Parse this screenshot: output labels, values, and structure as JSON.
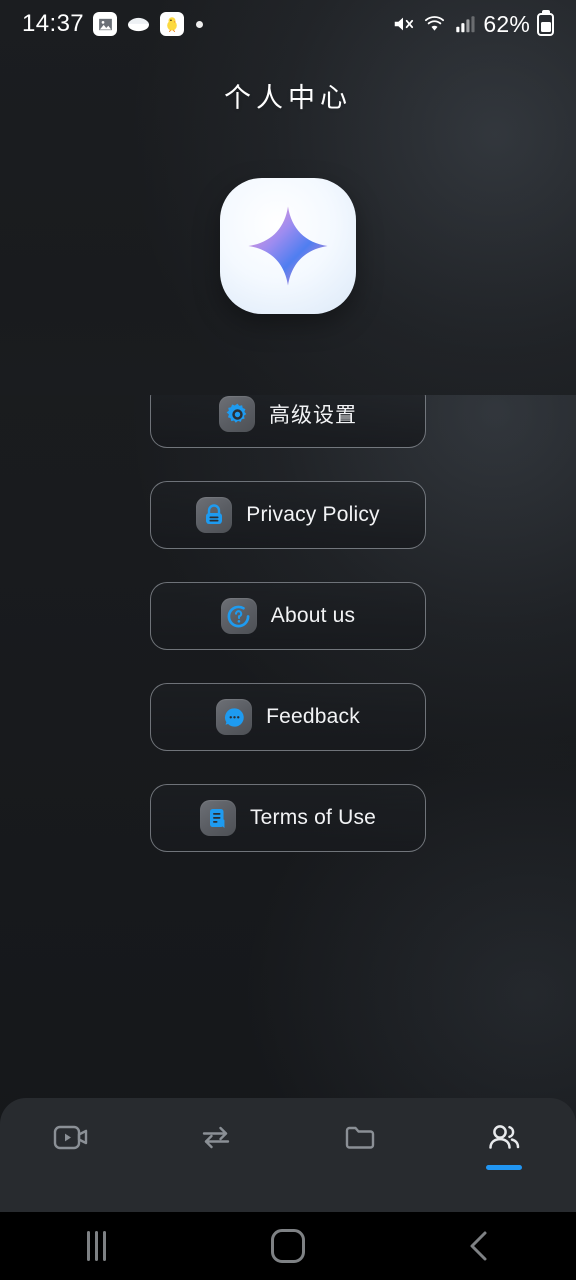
{
  "status_bar": {
    "time": "14:37",
    "battery_percent": "62%",
    "notification_icons": [
      "image-icon",
      "ellipse-icon",
      "chick-emoji-icon",
      "dot-indicator"
    ],
    "system_icons": [
      "mute-icon",
      "wifi-icon",
      "signal-bars-icon",
      "battery-icon"
    ]
  },
  "header": {
    "title": "个人中心",
    "logo_icon": "sparkle-star-icon",
    "gradient_colors": [
      "#a9b8e6",
      "#c79ed0",
      "#f4a09f",
      "#f3d7ac"
    ]
  },
  "menu": {
    "items": [
      {
        "label": "高级设置",
        "icon": "gear-icon",
        "name": "advanced-settings"
      },
      {
        "label": "Privacy Policy",
        "icon": "lock-icon",
        "name": "privacy-policy"
      },
      {
        "label": "About us",
        "icon": "question-circle-icon",
        "name": "about-us"
      },
      {
        "label": "Feedback",
        "icon": "chat-bubble-icon",
        "name": "feedback"
      },
      {
        "label": "Terms of Use",
        "icon": "document-icon",
        "name": "terms-of-use"
      }
    ],
    "icon_accent_color": "#1e9bf0"
  },
  "tab_bar": {
    "active_index": 3,
    "active_color": "#2196f3",
    "inactive_color": "#8b9096",
    "tabs": [
      {
        "icon": "video-camera-icon",
        "name": "tab-video"
      },
      {
        "icon": "transfer-arrows-icon",
        "name": "tab-transfer"
      },
      {
        "icon": "folder-icon",
        "name": "tab-files"
      },
      {
        "icon": "users-icon",
        "name": "tab-profile"
      }
    ]
  },
  "nav_bar": {
    "buttons": [
      {
        "icon": "recents-icon",
        "name": "nav-recents"
      },
      {
        "icon": "home-icon",
        "name": "nav-home"
      },
      {
        "icon": "back-chevron-icon",
        "name": "nav-back"
      }
    ]
  }
}
